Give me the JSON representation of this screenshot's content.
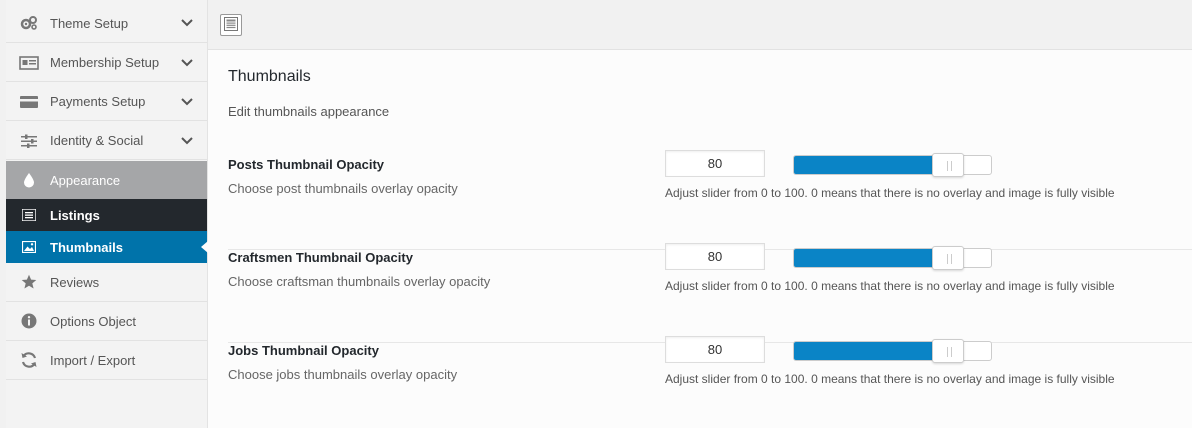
{
  "sidebar": {
    "items": [
      {
        "label": "Theme Setup",
        "icon": "gears-icon"
      },
      {
        "label": "Membership Setup",
        "icon": "id-card-icon"
      },
      {
        "label": "Payments Setup",
        "icon": "credit-card-icon"
      },
      {
        "label": "Identity & Social",
        "icon": "sliders-icon"
      },
      {
        "label": "Appearance",
        "icon": "drop-icon"
      },
      {
        "label": "Listings",
        "icon": "list-icon"
      },
      {
        "label": "Thumbnails",
        "icon": "image-icon"
      },
      {
        "label": "Reviews",
        "icon": "star-icon"
      },
      {
        "label": "Options Object",
        "icon": "info-icon"
      },
      {
        "label": "Import / Export",
        "icon": "refresh-icon"
      }
    ]
  },
  "section": {
    "title": "Thumbnails",
    "description": "Edit thumbnails appearance"
  },
  "fields": [
    {
      "title": "Posts Thumbnail Opacity",
      "subtitle": "Choose post thumbnails overlay opacity",
      "value": "80",
      "help": "Adjust slider from 0 to 100. 0 means that there is no overlay and image is fully visible"
    },
    {
      "title": "Craftsmen Thumbnail Opacity",
      "subtitle": "Choose craftsman thumbnails overlay opacity",
      "value": "80",
      "help": "Adjust slider from 0 to 100. 0 means that there is no overlay and image is fully visible"
    },
    {
      "title": "Jobs Thumbnail Opacity",
      "subtitle": "Choose jobs thumbnails overlay opacity",
      "value": "80",
      "help": "Adjust slider from 0 to 100. 0 means that there is no overlay and image is fully visible"
    }
  ],
  "colors": {
    "accent": "#0073aa",
    "slider_fill": "#0a84c6",
    "active_bg": "#a5a6a8",
    "sub_dark": "#23282d"
  }
}
